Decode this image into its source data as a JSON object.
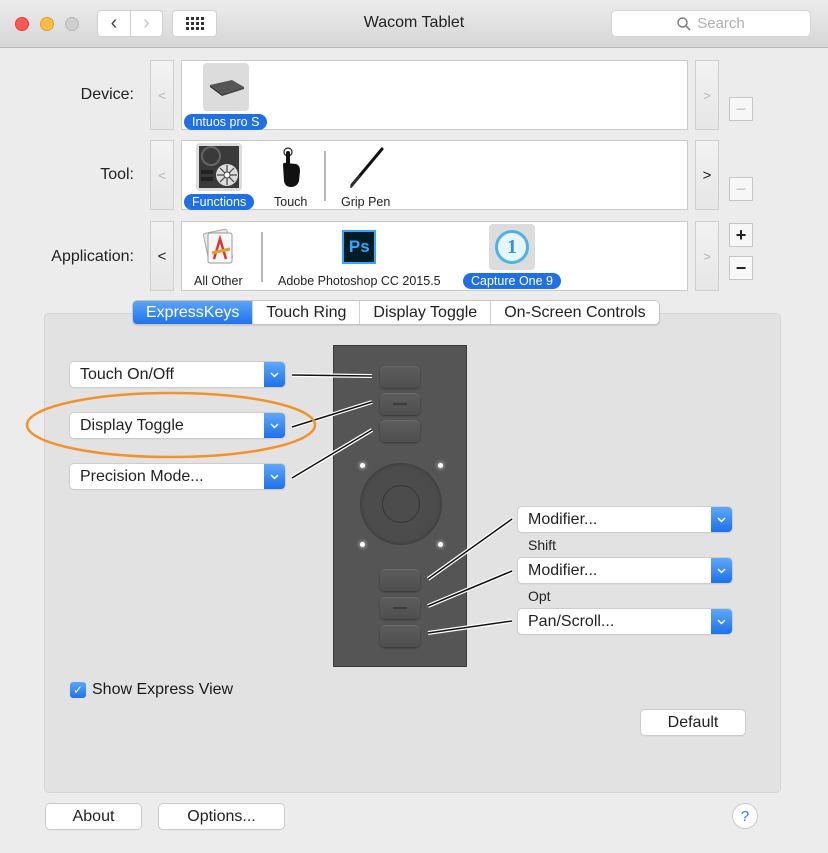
{
  "window": {
    "title": "Wacom Tablet",
    "search_placeholder": "Search"
  },
  "rows": {
    "device": {
      "label": "Device:",
      "items": [
        {
          "name": "Intuos pro S",
          "icon": "tablet-device-icon",
          "selected": true
        }
      ]
    },
    "tool": {
      "label": "Tool:",
      "items": [
        {
          "name": "Functions",
          "icon": "functions-icon",
          "selected": true
        },
        {
          "name": "Touch",
          "icon": "touch-hand-icon",
          "selected": false
        },
        {
          "name": "Grip Pen",
          "icon": "pen-icon",
          "selected": false
        }
      ]
    },
    "application": {
      "label": "Application:",
      "items": [
        {
          "name": "All Other",
          "icon": "all-other-apps-icon",
          "selected": false
        },
        {
          "name": "Adobe Photoshop CC 2015.5",
          "icon": "photoshop-icon",
          "icon_text": "Ps",
          "selected": false
        },
        {
          "name": "Capture One 9",
          "icon": "capture-one-icon",
          "icon_text": "1",
          "selected": true
        }
      ]
    }
  },
  "tabs": [
    {
      "label": "ExpressKeys",
      "active": true
    },
    {
      "label": "Touch Ring",
      "active": false
    },
    {
      "label": "Display Toggle",
      "active": false
    },
    {
      "label": "On-Screen Controls",
      "active": false
    }
  ],
  "expresskeys": {
    "left": [
      {
        "value": "Touch On/Off"
      },
      {
        "value": "Display Toggle",
        "highlighted": true
      },
      {
        "value": "Precision Mode..."
      }
    ],
    "right": [
      {
        "value": "Modifier...",
        "sublabel": "Shift"
      },
      {
        "value": "Modifier...",
        "sublabel": "Opt"
      },
      {
        "value": "Pan/Scroll..."
      }
    ]
  },
  "show_express_view": {
    "label": "Show Express View",
    "checked": true
  },
  "buttons": {
    "default": "Default",
    "about": "About",
    "options": "Options...",
    "help": "?"
  },
  "colors": {
    "accent": "#1f6fe6",
    "highlight_ring": "#f0932b"
  }
}
